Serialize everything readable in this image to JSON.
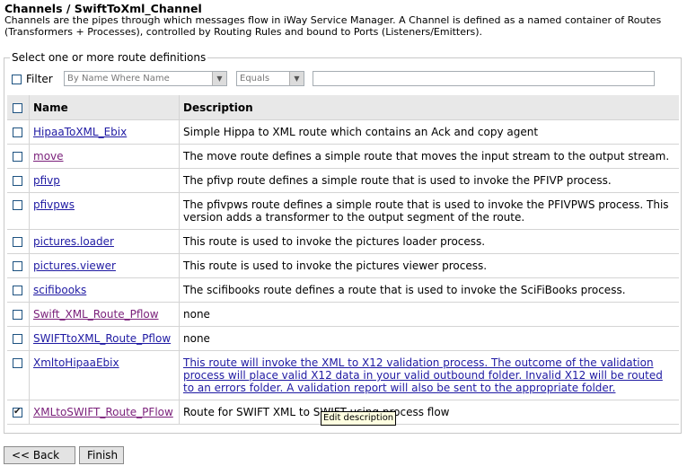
{
  "breadcrumb": "Channels / SwiftToXml_Channel",
  "intro": "Channels are the pipes through which messages flow in iWay Service Manager. A Channel is defined as a named container of Routes (Transformers + Processes), controlled by Routing Rules and bound to Ports (Listeners/Emitters).",
  "fieldset_legend": "Select one or more route definitions",
  "filter": {
    "label": "Filter",
    "field_select": "By Name Where Name",
    "operator_select": "Equals",
    "value": ""
  },
  "table": {
    "headers": {
      "name": "Name",
      "description": "Description"
    },
    "rows": [
      {
        "name": "HipaaToXML_Ebix",
        "description": "Simple Hippa to XML route which contains an Ack and copy agent",
        "checked": false,
        "visited": false
      },
      {
        "name": "move",
        "description": "The move route defines a simple route that moves the input stream to the output stream.",
        "checked": false,
        "visited": true
      },
      {
        "name": "pfivp",
        "description": "The pfivp route defines a simple route that is used to invoke the PFIVP process.",
        "checked": false,
        "visited": false
      },
      {
        "name": "pfivpws",
        "description": "The pfivpws route defines a simple route that is used to invoke the PFIVPWS process. This version adds a transformer to the output segment of the route.",
        "checked": false,
        "visited": false
      },
      {
        "name": "pictures.loader",
        "description": "This route is used to invoke the pictures loader process.",
        "checked": false,
        "visited": false
      },
      {
        "name": "pictures.viewer",
        "description": "This route is used to invoke the pictures viewer process.",
        "checked": false,
        "visited": false
      },
      {
        "name": "scifibooks",
        "description": "The scifibooks route defines a route that is used to invoke the SciFiBooks process.",
        "checked": false,
        "visited": false
      },
      {
        "name": "Swift_XML_Route_Pflow",
        "description": "none",
        "checked": false,
        "visited": true
      },
      {
        "name": "SWIFTtoXML_Route_Pflow",
        "description": "none",
        "checked": false,
        "visited": false
      },
      {
        "name": "XmltoHipaaEbix",
        "description": "This route will invoke the XML to X12 validation process. The outcome of the validation process will place valid X12 data in your valid outbound folder. Invalid X12 will be routed to an errors folder. A validation report will also be sent to the appropriate folder.",
        "checked": false,
        "visited": false,
        "desc_link": true
      },
      {
        "name": "XMLtoSWIFT_Route_PFlow",
        "description": "Route for SWIFT XML to SWIFT using process flow",
        "checked": true,
        "visited": true
      }
    ]
  },
  "tooltip": "Edit description",
  "buttons": {
    "back": "<< Back",
    "finish": "Finish"
  }
}
